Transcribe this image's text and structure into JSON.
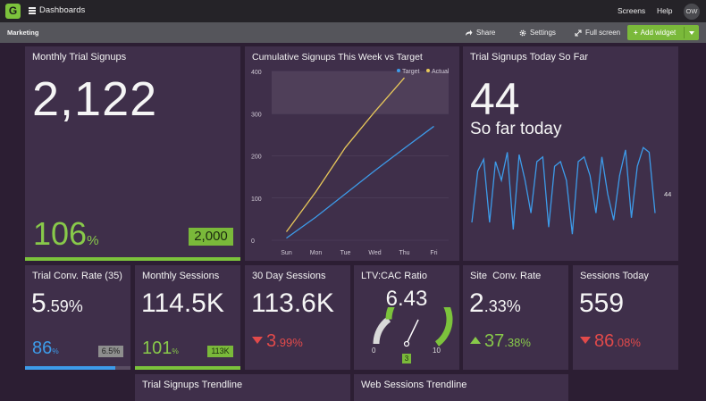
{
  "topbar": {
    "logo_letter": "G",
    "dashboards_label": "Dashboards",
    "screens_label": "Screens",
    "help_label": "Help",
    "avatar_initials": "OW"
  },
  "subbar": {
    "title": "Marketing",
    "share_label": "Share",
    "settings_label": "Settings",
    "fullscreen_label": "Full screen",
    "add_widget_label": "Add widget"
  },
  "colors": {
    "accent_green": "#7cc33c",
    "alert_red": "#e24a4a",
    "series_blue": "#3d9be9",
    "series_yellow": "#e8c85a",
    "tile_bg": "#3f2f4a"
  },
  "monthly_signups": {
    "title": "Monthly Trial Signups",
    "value": "2,122",
    "percent": "106",
    "percent_suffix": "%",
    "target": "2,000",
    "progress": 1.0
  },
  "cumulative": {
    "title": "Cumulative Signups This Week vs Target",
    "legend_target": "Target",
    "legend_actual": "Actual"
  },
  "chart_data": [
    {
      "type": "line",
      "title": "Cumulative Signups This Week vs Target",
      "x": [
        "Sun",
        "Mon",
        "Tue",
        "Wed",
        "Thu",
        "Fri"
      ],
      "ylim": [
        0,
        400
      ],
      "yticks": [
        0,
        100,
        200,
        300,
        400
      ],
      "series": [
        {
          "name": "Target",
          "color": "#3d9be9",
          "values": [
            5,
            55,
            110,
            165,
            218,
            270
          ]
        },
        {
          "name": "Actual",
          "color": "#e8c85a",
          "values": [
            20,
            115,
            220,
            305,
            385,
            null
          ]
        }
      ],
      "target_band": [
        300,
        400
      ],
      "legend": "top-right"
    },
    {
      "type": "line",
      "title": "Trial Signups Today So Far",
      "series": [
        {
          "name": "",
          "color": "#3d9be9",
          "values": [
            8,
            30,
            35,
            8,
            34,
            26,
            38,
            5,
            37,
            26,
            12,
            34,
            36,
            6,
            32,
            34,
            26,
            3,
            34,
            36,
            28,
            12,
            36,
            20,
            9,
            28,
            39,
            10,
            32,
            40,
            38,
            12
          ]
        }
      ],
      "last_value_label": "44"
    }
  ],
  "signups_today": {
    "title": "Trial Signups Today So Far",
    "value": "44",
    "subtitle": "So far today",
    "last_label": "44"
  },
  "conv_rate": {
    "title": "Trial Conv. Rate (35)",
    "value_int": "5",
    "value_dec": ".59%",
    "percent": "86",
    "percent_suffix": "%",
    "target": "6.5%",
    "progress": 0.86
  },
  "monthly_sessions": {
    "title": "Monthly Sessions",
    "value": "114.5K",
    "percent": "101",
    "percent_suffix": "%",
    "target": "113K",
    "progress": 1.0
  },
  "day30_sessions": {
    "title": "30 Day Sessions",
    "value": "113.6K",
    "change_int": "3",
    "change_dec": ".99%"
  },
  "ltv_cac": {
    "title": "LTV:CAC Ratio",
    "value": "6.43",
    "min": "0",
    "max": "10",
    "target": "3",
    "gauge_value": 6.43,
    "gauge_max": 10
  },
  "site_conv": {
    "title": "Site  Conv. Rate",
    "value_int": "2",
    "value_dec": ".33%",
    "change_int": "37",
    "change_dec": ".38%"
  },
  "sessions_today": {
    "title": "Sessions Today",
    "value": "559",
    "change_int": "86",
    "change_dec": ".08%"
  },
  "trendlines": {
    "signups_title": "Trial Signups Trendline",
    "web_title": "Web Sessions Trendline"
  }
}
